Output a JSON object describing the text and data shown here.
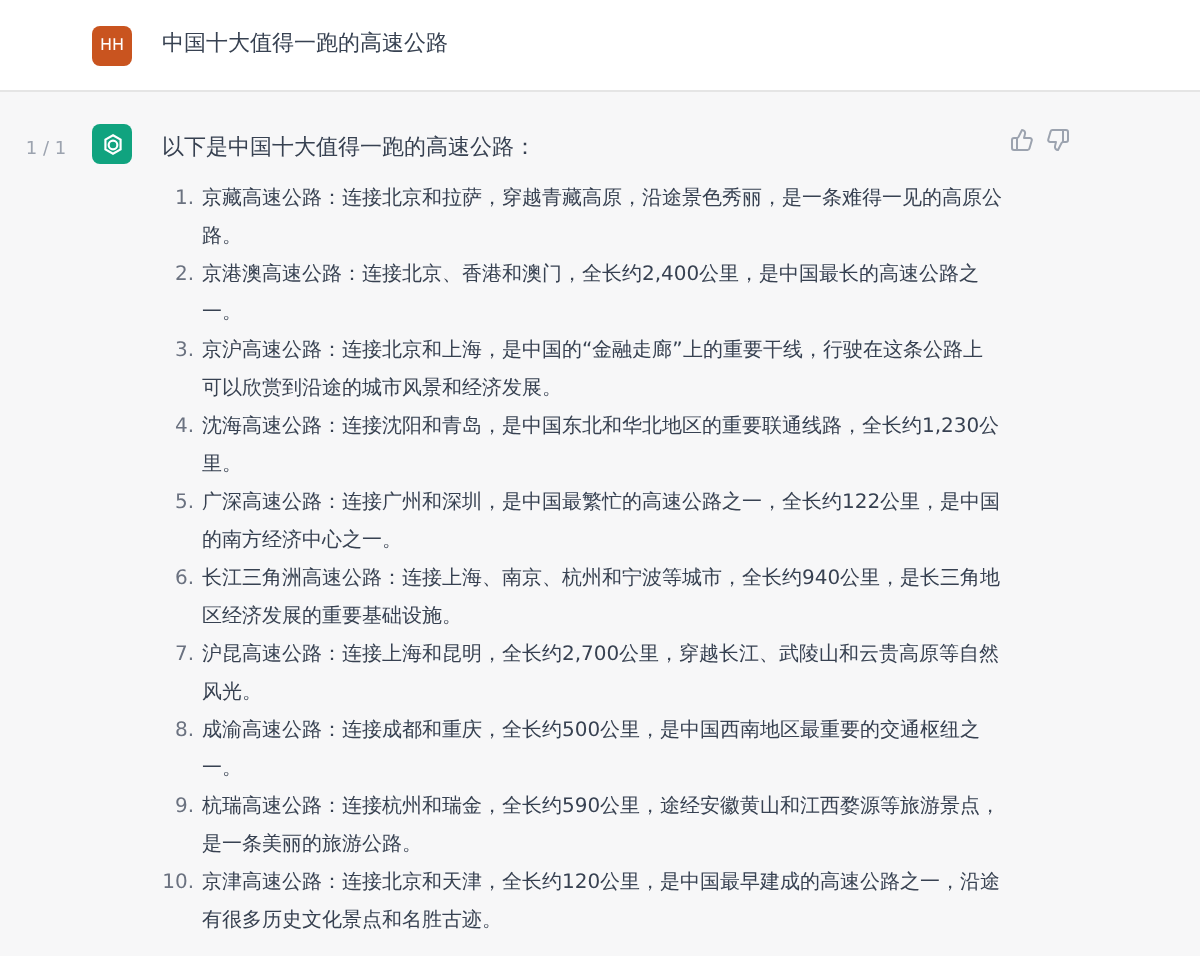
{
  "user_message": {
    "avatar": "HH",
    "text": "中国十大值得一跑的高速公路"
  },
  "assistant_message": {
    "pager": "1 / 1",
    "intro": "以下是中国十大值得一跑的高速公路：",
    "items": [
      {
        "number": "1.",
        "text": "京藏高速公路：连接北京和拉萨，穿越青藏高原，沿途景色秀丽，是一条难得一见的高原公路。"
      },
      {
        "number": "2.",
        "text": "京港澳高速公路：连接北京、香港和澳门，全长约2,400公里，是中国最长的高速公路之一。"
      },
      {
        "number": "3.",
        "text": "京沪高速公路：连接北京和上海，是中国的“金融走廊”上的重要干线，行驶在这条公路上可以欣赏到沿途的城市风景和经济发展。"
      },
      {
        "number": "4.",
        "text": "沈海高速公路：连接沈阳和青岛，是中国东北和华北地区的重要联通线路，全长约1,230公里。"
      },
      {
        "number": "5.",
        "text": "广深高速公路：连接广州和深圳，是中国最繁忙的高速公路之一，全长约122公里，是中国的南方经济中心之一。"
      },
      {
        "number": "6.",
        "text": "长江三角洲高速公路：连接上海、南京、杭州和宁波等城市，全长约940公里，是长三角地区经济发展的重要基础设施。"
      },
      {
        "number": "7.",
        "text": "沪昆高速公路：连接上海和昆明，全长约2,700公里，穿越长江、武陵山和云贵高原等自然风光。"
      },
      {
        "number": "8.",
        "text": "成渝高速公路：连接成都和重庆，全长约500公里，是中国西南地区最重要的交通枢纽之一。"
      },
      {
        "number": "9.",
        "text": "杭瑞高速公路：连接杭州和瑞金，全长约590公里，途经安徽黄山和江西婺源等旅游景点，是一条美丽的旅游公路。"
      },
      {
        "number": "10.",
        "text": "京津高速公路：连接北京和天津，全长约120公里，是中国最早建成的高速公路之一，沿途有很多历史文化景点和名胜古迹。"
      }
    ]
  }
}
